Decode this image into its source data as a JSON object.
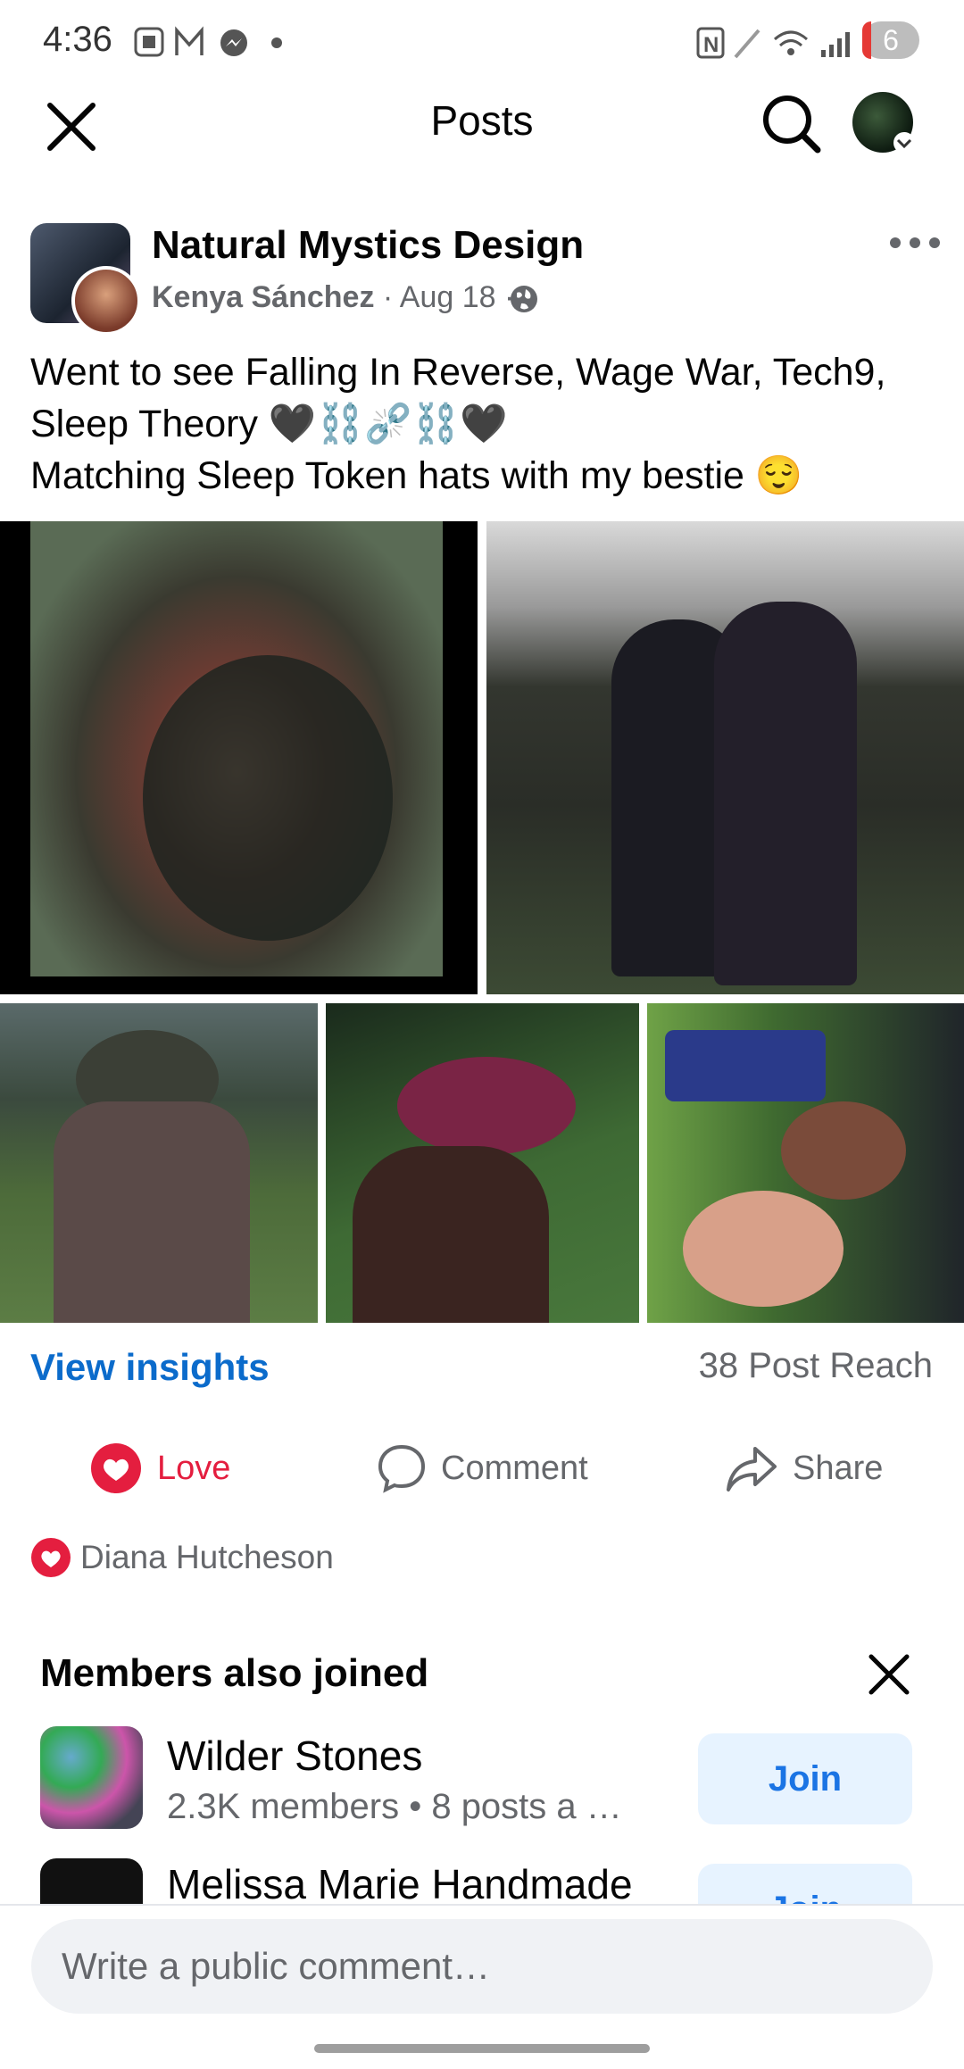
{
  "status_bar": {
    "time": "4:36",
    "battery": "6"
  },
  "app_bar": {
    "title": "Posts"
  },
  "post": {
    "group_name": "Natural Mystics Design",
    "author": "Kenya Sánchez",
    "date": "Aug 18",
    "separator": " · ",
    "text_line1": "Went to see Falling In Reverse, Wage War, Tech9,",
    "text_line2": "Sleep Theory 🖤⛓️⛓️‍💥⛓️🖤",
    "text_line3": "Matching Sleep Token hats with my bestie 😌",
    "insights_label": "View insights",
    "reach": "38 Post Reach",
    "actions": {
      "love": "Love",
      "comment": "Comment",
      "share": "Share"
    },
    "reactor": "Diana Hutcheson"
  },
  "members_also_joined": {
    "title": "Members also joined",
    "items": [
      {
        "name": "Wilder Stones",
        "subtitle": "2.3K members • 8 posts a …",
        "button": "Join"
      },
      {
        "name": "Melissa Marie Handmade",
        "subtitle": "",
        "button": "Join"
      }
    ]
  },
  "comment_box": {
    "placeholder": "Write a public comment…"
  },
  "colors": {
    "love": "#e41e3f",
    "link": "#0b6bcb",
    "join_bg": "#e7f3ff",
    "join_text": "#1b74e4"
  }
}
